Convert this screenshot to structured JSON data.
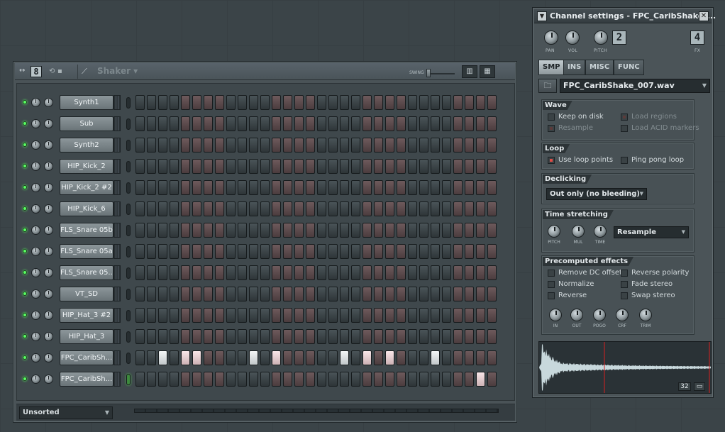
{
  "sequencer": {
    "pattern_number": "8",
    "pattern_name": "Shaker",
    "swing_label": "SWING",
    "swing_level": 0.0,
    "sort_label": "Unsorted",
    "channels": [
      {
        "name": "Synth1",
        "selected": false,
        "steps": []
      },
      {
        "name": "Sub",
        "selected": false,
        "steps": []
      },
      {
        "name": "Synth2",
        "selected": false,
        "steps": []
      },
      {
        "name": "HIP_Kick_2",
        "selected": false,
        "steps": []
      },
      {
        "name": "HIP_Kick_2 #2",
        "selected": false,
        "steps": []
      },
      {
        "name": "HIP_Kick_6",
        "selected": false,
        "steps": []
      },
      {
        "name": "FLS_Snare 05b",
        "selected": false,
        "steps": []
      },
      {
        "name": "FLS_Snare 05a",
        "selected": false,
        "steps": []
      },
      {
        "name": "FLS_Snare 05...",
        "selected": false,
        "steps": []
      },
      {
        "name": "VT_SD",
        "selected": false,
        "steps": []
      },
      {
        "name": "HIP_Hat_3 #2",
        "selected": false,
        "steps": []
      },
      {
        "name": "HIP_Hat_3",
        "selected": false,
        "steps": []
      },
      {
        "name": "FPC_CaribSh...",
        "selected": false,
        "steps": [
          2,
          4,
          5,
          10,
          12,
          18,
          20,
          22,
          26
        ]
      },
      {
        "name": "FPC_CaribSh...",
        "selected": true,
        "steps": [
          30
        ]
      }
    ],
    "steps_per_row": 32
  },
  "channel_settings": {
    "title": "Channel settings - FPC_CaribShake_...",
    "knob_labels": {
      "pan": "PAN",
      "vol": "VOL",
      "pitch": "PITCH",
      "fx": "FX"
    },
    "pitch_range": "2",
    "fx_number": "4",
    "tabs": [
      "SMP",
      "INS",
      "MISC",
      "FUNC"
    ],
    "active_tab": "SMP",
    "sample_file": "FPC_CaribShake_007.wav",
    "wave": {
      "title": "Wave",
      "options": [
        {
          "label": "Keep on disk",
          "checked": false,
          "enabled": true
        },
        {
          "label": "Load regions",
          "checked": true,
          "enabled": false
        },
        {
          "label": "Resample",
          "checked": true,
          "enabled": false
        },
        {
          "label": "Load ACID markers",
          "checked": false,
          "enabled": false
        }
      ]
    },
    "loop": {
      "title": "Loop",
      "options": [
        {
          "label": "Use loop points",
          "checked": true,
          "enabled": true
        },
        {
          "label": "Ping pong loop",
          "checked": false,
          "enabled": true
        }
      ]
    },
    "declicking": {
      "title": "Declicking",
      "mode": "Out only (no bleeding)"
    },
    "time_stretching": {
      "title": "Time stretching",
      "knob_labels": [
        "PITCH",
        "MUL",
        "TIME"
      ],
      "mode": "Resample"
    },
    "precomputed": {
      "title": "Precomputed effects",
      "options": [
        {
          "label": "Remove DC offset",
          "checked": false
        },
        {
          "label": "Reverse polarity",
          "checked": false
        },
        {
          "label": "Normalize",
          "checked": false
        },
        {
          "label": "Fade stereo",
          "checked": false
        },
        {
          "label": "Reverse",
          "checked": false
        },
        {
          "label": "Swap stereo",
          "checked": false
        }
      ],
      "knob_labels": [
        "IN",
        "OUT",
        "POGO",
        "CRF",
        "TRIM"
      ]
    },
    "waveform": {
      "zoom_label": "32"
    }
  },
  "colors": {
    "led_green": "#59ff62",
    "step_on": "#f3f5f6",
    "checkbox_on": "#e04d46",
    "wave_color": "#c8d8dc",
    "marker_red": "#d62020"
  }
}
